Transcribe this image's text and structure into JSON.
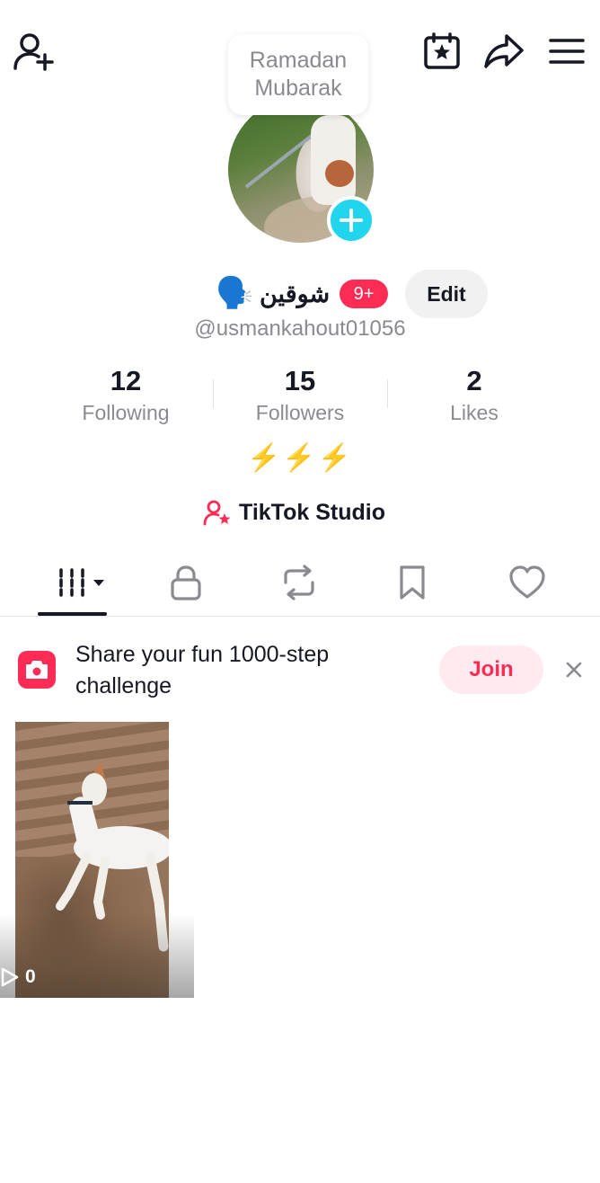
{
  "header": {
    "add_friend_icon": "person-plus-icon",
    "calendar_icon": "calendar-star-icon",
    "share_icon": "share-arrow-icon",
    "menu_icon": "hamburger-menu-icon"
  },
  "bubble": {
    "line1": "Ramadan",
    "line2": "Mubarak"
  },
  "profile": {
    "display_name": "شوقين",
    "name_emoji": "🗣️",
    "notification_count": "9+",
    "edit_label": "Edit",
    "handle": "@usmankahout01056"
  },
  "stats": [
    {
      "value": "12",
      "label": "Following"
    },
    {
      "value": "15",
      "label": "Followers"
    },
    {
      "value": "2",
      "label": "Likes"
    }
  ],
  "bio": "⚡⚡⚡",
  "studio": {
    "label": "TikTok Studio"
  },
  "tabs": [
    {
      "name": "videos-grid",
      "icon": "grid-bars-icon",
      "active": true
    },
    {
      "name": "private",
      "icon": "lock-icon"
    },
    {
      "name": "reposts",
      "icon": "repost-icon"
    },
    {
      "name": "favorites",
      "icon": "bookmark-icon"
    },
    {
      "name": "liked",
      "icon": "heart-icon"
    }
  ],
  "challenge": {
    "line1": "Share your fun 1000-step",
    "line2": "challenge",
    "join_label": "Join"
  },
  "videos": [
    {
      "views": "0"
    }
  ],
  "colors": {
    "accent": "#fe2c55",
    "cyan": "#20d5ec",
    "text": "#161823",
    "muted": "#8a8b91"
  }
}
